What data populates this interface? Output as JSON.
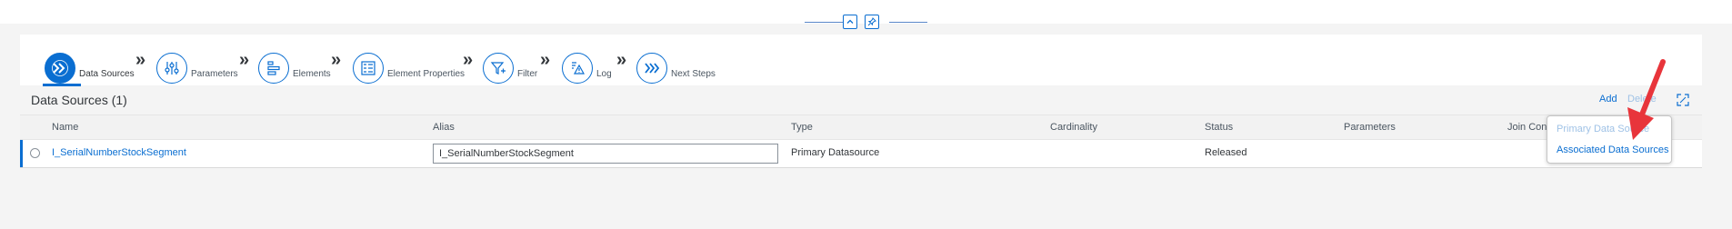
{
  "wizard": {
    "steps": [
      {
        "label": "Data Sources",
        "icon": "data-sources-icon",
        "active": true
      },
      {
        "label": "Parameters",
        "icon": "parameters-icon",
        "active": false
      },
      {
        "label": "Elements",
        "icon": "elements-icon",
        "active": false
      },
      {
        "label": "Element Properties",
        "icon": "element-properties-icon",
        "active": false
      },
      {
        "label": "Filter",
        "icon": "filter-icon",
        "active": false
      },
      {
        "label": "Log",
        "icon": "log-icon",
        "active": false
      },
      {
        "label": "Next Steps",
        "icon": "next-steps-icon",
        "active": false
      }
    ],
    "separator": "»"
  },
  "section": {
    "title": "Data Sources (1)"
  },
  "toolbar": {
    "add_label": "Add",
    "delete_label": "Delete"
  },
  "table": {
    "columns": [
      "Name",
      "Alias",
      "Type",
      "Cardinality",
      "Status",
      "Parameters",
      "Join Conditions"
    ],
    "rows": [
      {
        "name": "I_SerialNumberStockSegment",
        "alias": "I_SerialNumberStockSegment",
        "type": "Primary Datasource",
        "cardinality": "",
        "status": "Released",
        "parameters": ""
      }
    ]
  },
  "add_menu": {
    "items": [
      {
        "label": "Primary Data Source",
        "enabled": false
      },
      {
        "label": "Associated Data Sources",
        "enabled": true
      }
    ]
  },
  "colors": {
    "accent": "#0a6ed1",
    "disabled_link": "#9fc2e6",
    "annotation_arrow": "#e8353b"
  }
}
